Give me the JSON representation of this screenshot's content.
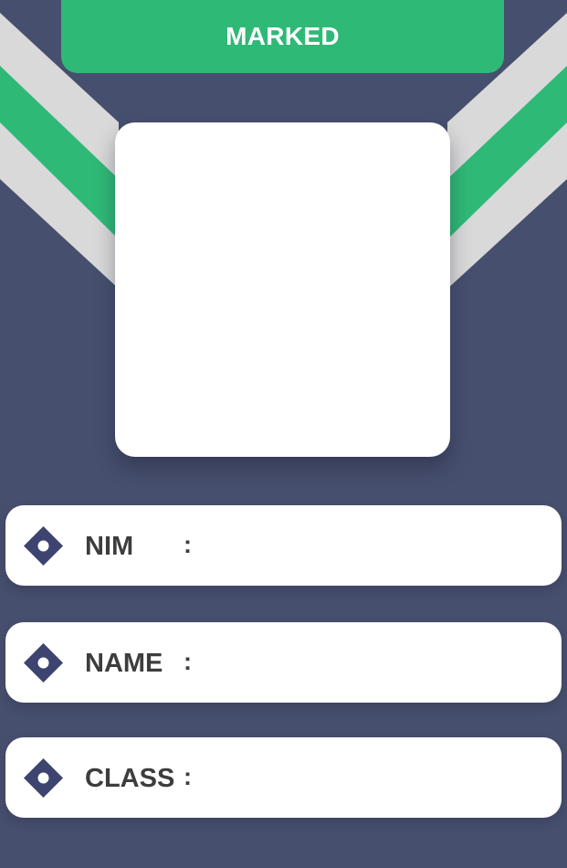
{
  "status": {
    "label": "MARKED"
  },
  "photo": {
    "content": ""
  },
  "fields": [
    {
      "label": "NIM",
      "separator": ":",
      "value": ""
    },
    {
      "label": "NAME",
      "separator": ":",
      "value": ""
    },
    {
      "label": "CLASS",
      "separator": ":",
      "value": ""
    }
  ],
  "colors": {
    "background": "#474f6e",
    "accent_green": "#2fb976",
    "stripe_gray": "#d9d9d9",
    "card_white": "#ffffff",
    "icon_navy": "#3d4470",
    "text_dark": "#3d3d3d"
  },
  "icons": {
    "row_marker": "diamond-icon"
  }
}
